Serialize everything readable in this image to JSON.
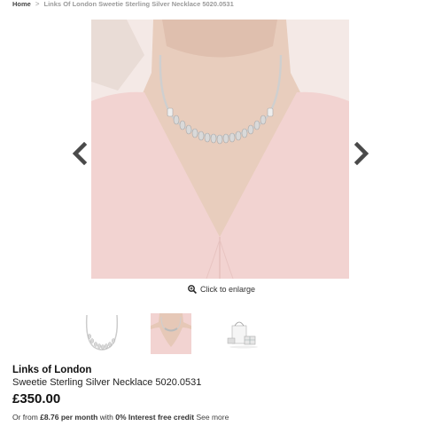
{
  "breadcrumb": {
    "home": "Home",
    "separator": ">",
    "current": "Links Of London Sweetie Sterling Silver Necklace 5020.0531"
  },
  "gallery": {
    "enlarge_label": "Click to enlarge",
    "prev_icon": "chevron-left-icon",
    "next_icon": "chevron-right-icon",
    "thumbnails": [
      "necklace-flat",
      "necklace-worn",
      "gift-packaging"
    ],
    "selected_thumbnail": 2
  },
  "product": {
    "brand": "Links of London",
    "name": "Sweetie Sterling Silver Necklace 5020.0531",
    "price": "£350.00"
  },
  "finance": {
    "prefix": "Or from",
    "monthly": "£8.76 per month",
    "with": "with",
    "interest": "0% Interest free credit",
    "see_more": "See more"
  },
  "colors": {
    "background": "#ffffff",
    "arrow": "#4a4a4a",
    "skin": "#e7c8b4",
    "dress": "#f2d4d2"
  }
}
